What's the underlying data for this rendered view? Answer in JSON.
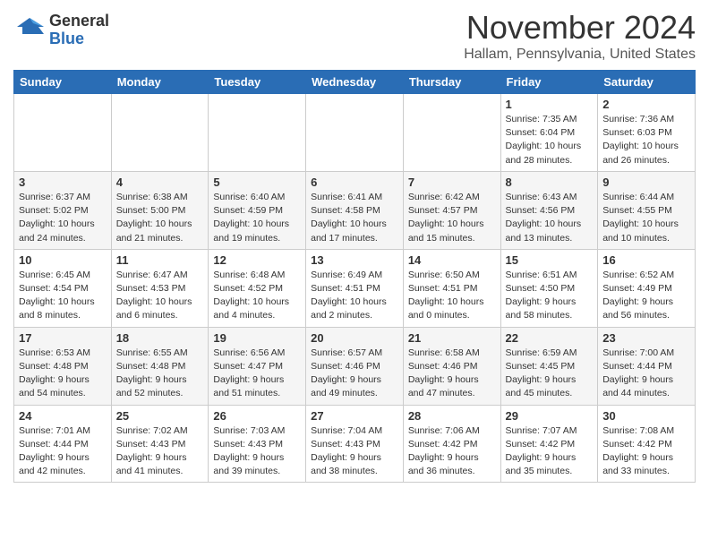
{
  "header": {
    "logo_general": "General",
    "logo_blue": "Blue",
    "month_title": "November 2024",
    "location": "Hallam, Pennsylvania, United States"
  },
  "days_of_week": [
    "Sunday",
    "Monday",
    "Tuesday",
    "Wednesday",
    "Thursday",
    "Friday",
    "Saturday"
  ],
  "weeks": [
    [
      {
        "day": "",
        "info": ""
      },
      {
        "day": "",
        "info": ""
      },
      {
        "day": "",
        "info": ""
      },
      {
        "day": "",
        "info": ""
      },
      {
        "day": "",
        "info": ""
      },
      {
        "day": "1",
        "info": "Sunrise: 7:35 AM\nSunset: 6:04 PM\nDaylight: 10 hours and 28 minutes."
      },
      {
        "day": "2",
        "info": "Sunrise: 7:36 AM\nSunset: 6:03 PM\nDaylight: 10 hours and 26 minutes."
      }
    ],
    [
      {
        "day": "3",
        "info": "Sunrise: 6:37 AM\nSunset: 5:02 PM\nDaylight: 10 hours and 24 minutes."
      },
      {
        "day": "4",
        "info": "Sunrise: 6:38 AM\nSunset: 5:00 PM\nDaylight: 10 hours and 21 minutes."
      },
      {
        "day": "5",
        "info": "Sunrise: 6:40 AM\nSunset: 4:59 PM\nDaylight: 10 hours and 19 minutes."
      },
      {
        "day": "6",
        "info": "Sunrise: 6:41 AM\nSunset: 4:58 PM\nDaylight: 10 hours and 17 minutes."
      },
      {
        "day": "7",
        "info": "Sunrise: 6:42 AM\nSunset: 4:57 PM\nDaylight: 10 hours and 15 minutes."
      },
      {
        "day": "8",
        "info": "Sunrise: 6:43 AM\nSunset: 4:56 PM\nDaylight: 10 hours and 13 minutes."
      },
      {
        "day": "9",
        "info": "Sunrise: 6:44 AM\nSunset: 4:55 PM\nDaylight: 10 hours and 10 minutes."
      }
    ],
    [
      {
        "day": "10",
        "info": "Sunrise: 6:45 AM\nSunset: 4:54 PM\nDaylight: 10 hours and 8 minutes."
      },
      {
        "day": "11",
        "info": "Sunrise: 6:47 AM\nSunset: 4:53 PM\nDaylight: 10 hours and 6 minutes."
      },
      {
        "day": "12",
        "info": "Sunrise: 6:48 AM\nSunset: 4:52 PM\nDaylight: 10 hours and 4 minutes."
      },
      {
        "day": "13",
        "info": "Sunrise: 6:49 AM\nSunset: 4:51 PM\nDaylight: 10 hours and 2 minutes."
      },
      {
        "day": "14",
        "info": "Sunrise: 6:50 AM\nSunset: 4:51 PM\nDaylight: 10 hours and 0 minutes."
      },
      {
        "day": "15",
        "info": "Sunrise: 6:51 AM\nSunset: 4:50 PM\nDaylight: 9 hours and 58 minutes."
      },
      {
        "day": "16",
        "info": "Sunrise: 6:52 AM\nSunset: 4:49 PM\nDaylight: 9 hours and 56 minutes."
      }
    ],
    [
      {
        "day": "17",
        "info": "Sunrise: 6:53 AM\nSunset: 4:48 PM\nDaylight: 9 hours and 54 minutes."
      },
      {
        "day": "18",
        "info": "Sunrise: 6:55 AM\nSunset: 4:48 PM\nDaylight: 9 hours and 52 minutes."
      },
      {
        "day": "19",
        "info": "Sunrise: 6:56 AM\nSunset: 4:47 PM\nDaylight: 9 hours and 51 minutes."
      },
      {
        "day": "20",
        "info": "Sunrise: 6:57 AM\nSunset: 4:46 PM\nDaylight: 9 hours and 49 minutes."
      },
      {
        "day": "21",
        "info": "Sunrise: 6:58 AM\nSunset: 4:46 PM\nDaylight: 9 hours and 47 minutes."
      },
      {
        "day": "22",
        "info": "Sunrise: 6:59 AM\nSunset: 4:45 PM\nDaylight: 9 hours and 45 minutes."
      },
      {
        "day": "23",
        "info": "Sunrise: 7:00 AM\nSunset: 4:44 PM\nDaylight: 9 hours and 44 minutes."
      }
    ],
    [
      {
        "day": "24",
        "info": "Sunrise: 7:01 AM\nSunset: 4:44 PM\nDaylight: 9 hours and 42 minutes."
      },
      {
        "day": "25",
        "info": "Sunrise: 7:02 AM\nSunset: 4:43 PM\nDaylight: 9 hours and 41 minutes."
      },
      {
        "day": "26",
        "info": "Sunrise: 7:03 AM\nSunset: 4:43 PM\nDaylight: 9 hours and 39 minutes."
      },
      {
        "day": "27",
        "info": "Sunrise: 7:04 AM\nSunset: 4:43 PM\nDaylight: 9 hours and 38 minutes."
      },
      {
        "day": "28",
        "info": "Sunrise: 7:06 AM\nSunset: 4:42 PM\nDaylight: 9 hours and 36 minutes."
      },
      {
        "day": "29",
        "info": "Sunrise: 7:07 AM\nSunset: 4:42 PM\nDaylight: 9 hours and 35 minutes."
      },
      {
        "day": "30",
        "info": "Sunrise: 7:08 AM\nSunset: 4:42 PM\nDaylight: 9 hours and 33 minutes."
      }
    ]
  ]
}
